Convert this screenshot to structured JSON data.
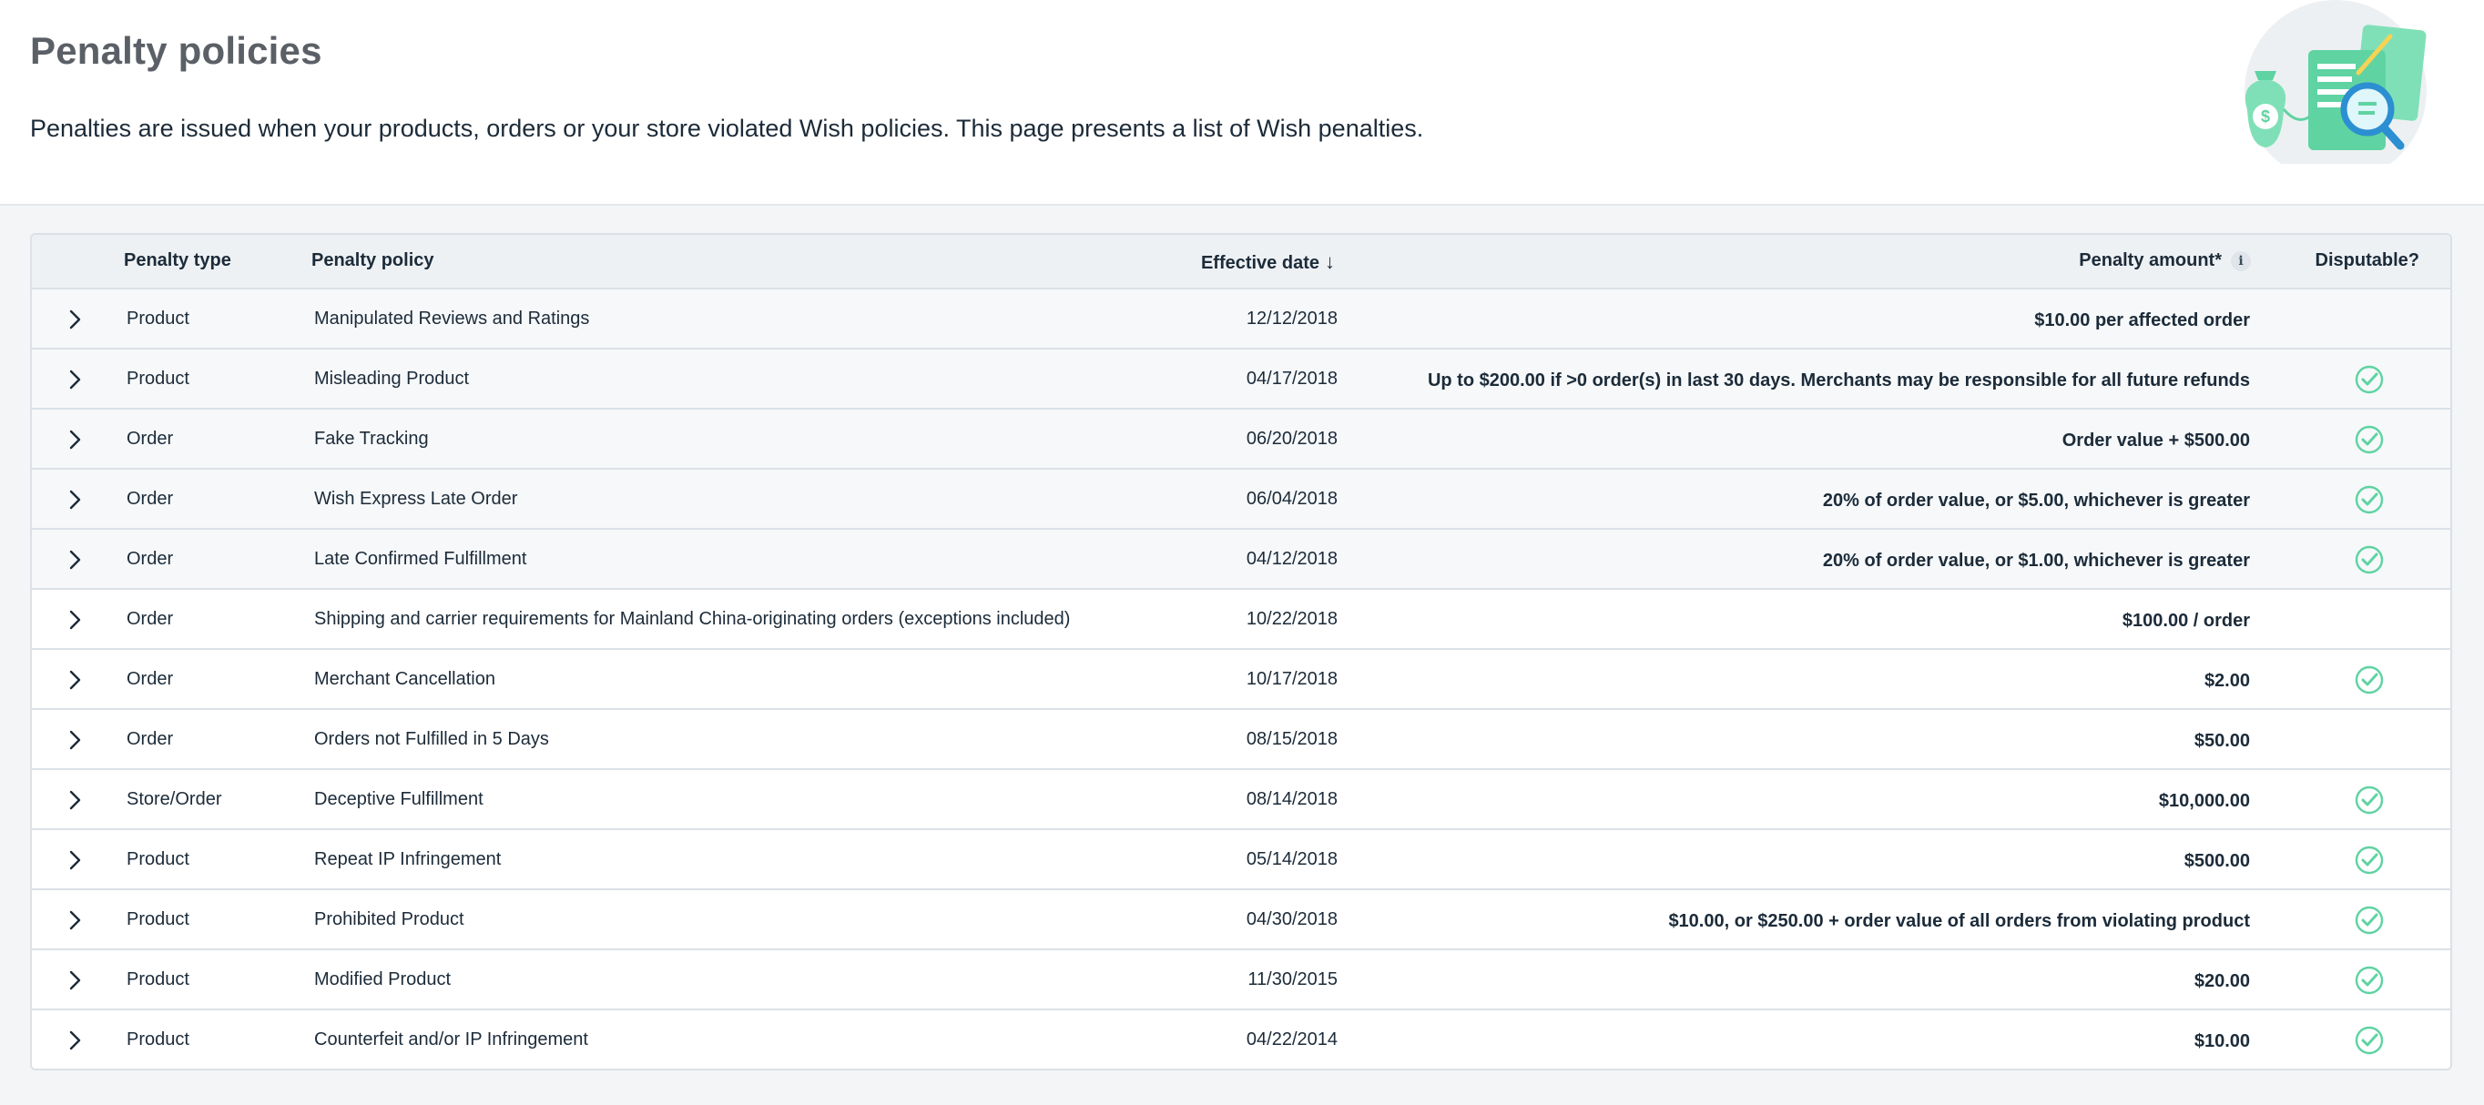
{
  "header": {
    "title": "Penalty policies",
    "description": "Penalties are issued when your products, orders or your store violated Wish policies. This page presents a list of Wish penalties."
  },
  "table": {
    "columns": {
      "penalty_type": "Penalty type",
      "penalty_policy": "Penalty policy",
      "effective_date": "Effective date",
      "penalty_amount": "Penalty amount*",
      "disputable": "Disputable?",
      "info_icon_label": "i"
    },
    "rows": [
      {
        "type": "Product",
        "policy": "Manipulated Reviews and Ratings",
        "date": "12/12/2018",
        "amount": "$10.00 per affected order",
        "disputable": false
      },
      {
        "type": "Product",
        "policy": "Misleading Product",
        "date": "04/17/2018",
        "amount": "Up to $200.00 if >0 order(s) in last 30 days. Merchants may be responsible for all future refunds",
        "disputable": true
      },
      {
        "type": "Order",
        "policy": "Fake Tracking",
        "date": "06/20/2018",
        "amount": "Order value + $500.00",
        "disputable": true
      },
      {
        "type": "Order",
        "policy": "Wish Express Late Order",
        "date": "06/04/2018",
        "amount": "20% of order value, or $5.00, whichever is greater",
        "disputable": true
      },
      {
        "type": "Order",
        "policy": "Late Confirmed Fulfillment",
        "date": "04/12/2018",
        "amount": "20% of order value, or $1.00, whichever is greater",
        "disputable": true
      },
      {
        "type": "Order",
        "policy": "Shipping and carrier requirements for Mainland China-originating orders (exceptions included)",
        "date": "10/22/2018",
        "amount": "$100.00 / order",
        "disputable": false
      },
      {
        "type": "Order",
        "policy": "Merchant Cancellation",
        "date": "10/17/2018",
        "amount": "$2.00",
        "disputable": true
      },
      {
        "type": "Order",
        "policy": "Orders not Fulfilled in 5 Days",
        "date": "08/15/2018",
        "amount": "$50.00",
        "disputable": false
      },
      {
        "type": "Store/Order",
        "policy": "Deceptive Fulfillment",
        "date": "08/14/2018",
        "amount": "$10,000.00",
        "disputable": true
      },
      {
        "type": "Product",
        "policy": "Repeat IP Infringement",
        "date": "05/14/2018",
        "amount": "$500.00",
        "disputable": true
      },
      {
        "type": "Product",
        "policy": "Prohibited Product",
        "date": "04/30/2018",
        "amount": "$10.00, or $250.00 + order value of all orders from violating product",
        "disputable": true
      },
      {
        "type": "Product",
        "policy": "Modified Product",
        "date": "11/30/2015",
        "amount": "$20.00",
        "disputable": true
      },
      {
        "type": "Product",
        "policy": "Counterfeit and/or IP Infringement",
        "date": "04/22/2014",
        "amount": "$10.00",
        "disputable": true
      }
    ]
  },
  "icons": {
    "expand": "chevron-right-icon",
    "disputable": "check-circle-icon",
    "sort": "arrow-down-icon",
    "info": "info-icon"
  },
  "colors": {
    "accent_green": "#5fd3a2",
    "title_gray": "#5b6066",
    "text": "#1c2b39"
  }
}
